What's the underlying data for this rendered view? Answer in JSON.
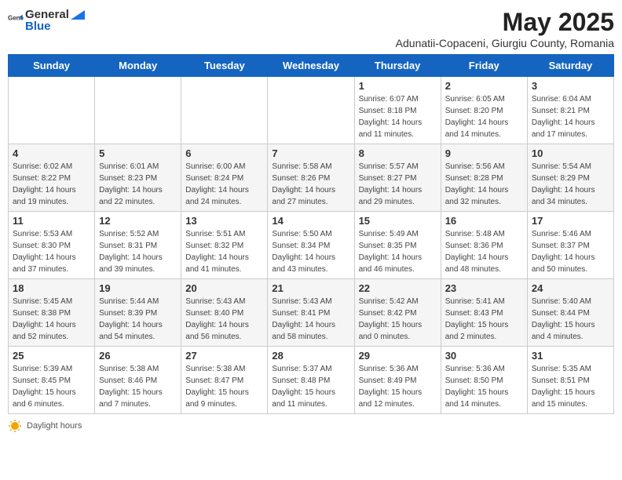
{
  "header": {
    "logo_general": "General",
    "logo_blue": "Blue",
    "month_title": "May 2025",
    "location": "Adunatii-Copaceni, Giurgiu County, Romania"
  },
  "days_of_week": [
    "Sunday",
    "Monday",
    "Tuesday",
    "Wednesday",
    "Thursday",
    "Friday",
    "Saturday"
  ],
  "weeks": [
    [
      {
        "day": "",
        "info": ""
      },
      {
        "day": "",
        "info": ""
      },
      {
        "day": "",
        "info": ""
      },
      {
        "day": "",
        "info": ""
      },
      {
        "day": "1",
        "info": "Sunrise: 6:07 AM\nSunset: 8:18 PM\nDaylight: 14 hours\nand 11 minutes."
      },
      {
        "day": "2",
        "info": "Sunrise: 6:05 AM\nSunset: 8:20 PM\nDaylight: 14 hours\nand 14 minutes."
      },
      {
        "day": "3",
        "info": "Sunrise: 6:04 AM\nSunset: 8:21 PM\nDaylight: 14 hours\nand 17 minutes."
      }
    ],
    [
      {
        "day": "4",
        "info": "Sunrise: 6:02 AM\nSunset: 8:22 PM\nDaylight: 14 hours\nand 19 minutes."
      },
      {
        "day": "5",
        "info": "Sunrise: 6:01 AM\nSunset: 8:23 PM\nDaylight: 14 hours\nand 22 minutes."
      },
      {
        "day": "6",
        "info": "Sunrise: 6:00 AM\nSunset: 8:24 PM\nDaylight: 14 hours\nand 24 minutes."
      },
      {
        "day": "7",
        "info": "Sunrise: 5:58 AM\nSunset: 8:26 PM\nDaylight: 14 hours\nand 27 minutes."
      },
      {
        "day": "8",
        "info": "Sunrise: 5:57 AM\nSunset: 8:27 PM\nDaylight: 14 hours\nand 29 minutes."
      },
      {
        "day": "9",
        "info": "Sunrise: 5:56 AM\nSunset: 8:28 PM\nDaylight: 14 hours\nand 32 minutes."
      },
      {
        "day": "10",
        "info": "Sunrise: 5:54 AM\nSunset: 8:29 PM\nDaylight: 14 hours\nand 34 minutes."
      }
    ],
    [
      {
        "day": "11",
        "info": "Sunrise: 5:53 AM\nSunset: 8:30 PM\nDaylight: 14 hours\nand 37 minutes."
      },
      {
        "day": "12",
        "info": "Sunrise: 5:52 AM\nSunset: 8:31 PM\nDaylight: 14 hours\nand 39 minutes."
      },
      {
        "day": "13",
        "info": "Sunrise: 5:51 AM\nSunset: 8:32 PM\nDaylight: 14 hours\nand 41 minutes."
      },
      {
        "day": "14",
        "info": "Sunrise: 5:50 AM\nSunset: 8:34 PM\nDaylight: 14 hours\nand 43 minutes."
      },
      {
        "day": "15",
        "info": "Sunrise: 5:49 AM\nSunset: 8:35 PM\nDaylight: 14 hours\nand 46 minutes."
      },
      {
        "day": "16",
        "info": "Sunrise: 5:48 AM\nSunset: 8:36 PM\nDaylight: 14 hours\nand 48 minutes."
      },
      {
        "day": "17",
        "info": "Sunrise: 5:46 AM\nSunset: 8:37 PM\nDaylight: 14 hours\nand 50 minutes."
      }
    ],
    [
      {
        "day": "18",
        "info": "Sunrise: 5:45 AM\nSunset: 8:38 PM\nDaylight: 14 hours\nand 52 minutes."
      },
      {
        "day": "19",
        "info": "Sunrise: 5:44 AM\nSunset: 8:39 PM\nDaylight: 14 hours\nand 54 minutes."
      },
      {
        "day": "20",
        "info": "Sunrise: 5:43 AM\nSunset: 8:40 PM\nDaylight: 14 hours\nand 56 minutes."
      },
      {
        "day": "21",
        "info": "Sunrise: 5:43 AM\nSunset: 8:41 PM\nDaylight: 14 hours\nand 58 minutes."
      },
      {
        "day": "22",
        "info": "Sunrise: 5:42 AM\nSunset: 8:42 PM\nDaylight: 15 hours\nand 0 minutes."
      },
      {
        "day": "23",
        "info": "Sunrise: 5:41 AM\nSunset: 8:43 PM\nDaylight: 15 hours\nand 2 minutes."
      },
      {
        "day": "24",
        "info": "Sunrise: 5:40 AM\nSunset: 8:44 PM\nDaylight: 15 hours\nand 4 minutes."
      }
    ],
    [
      {
        "day": "25",
        "info": "Sunrise: 5:39 AM\nSunset: 8:45 PM\nDaylight: 15 hours\nand 6 minutes."
      },
      {
        "day": "26",
        "info": "Sunrise: 5:38 AM\nSunset: 8:46 PM\nDaylight: 15 hours\nand 7 minutes."
      },
      {
        "day": "27",
        "info": "Sunrise: 5:38 AM\nSunset: 8:47 PM\nDaylight: 15 hours\nand 9 minutes."
      },
      {
        "day": "28",
        "info": "Sunrise: 5:37 AM\nSunset: 8:48 PM\nDaylight: 15 hours\nand 11 minutes."
      },
      {
        "day": "29",
        "info": "Sunrise: 5:36 AM\nSunset: 8:49 PM\nDaylight: 15 hours\nand 12 minutes."
      },
      {
        "day": "30",
        "info": "Sunrise: 5:36 AM\nSunset: 8:50 PM\nDaylight: 15 hours\nand 14 minutes."
      },
      {
        "day": "31",
        "info": "Sunrise: 5:35 AM\nSunset: 8:51 PM\nDaylight: 15 hours\nand 15 minutes."
      }
    ]
  ],
  "footer": {
    "daylight_label": "Daylight hours"
  }
}
